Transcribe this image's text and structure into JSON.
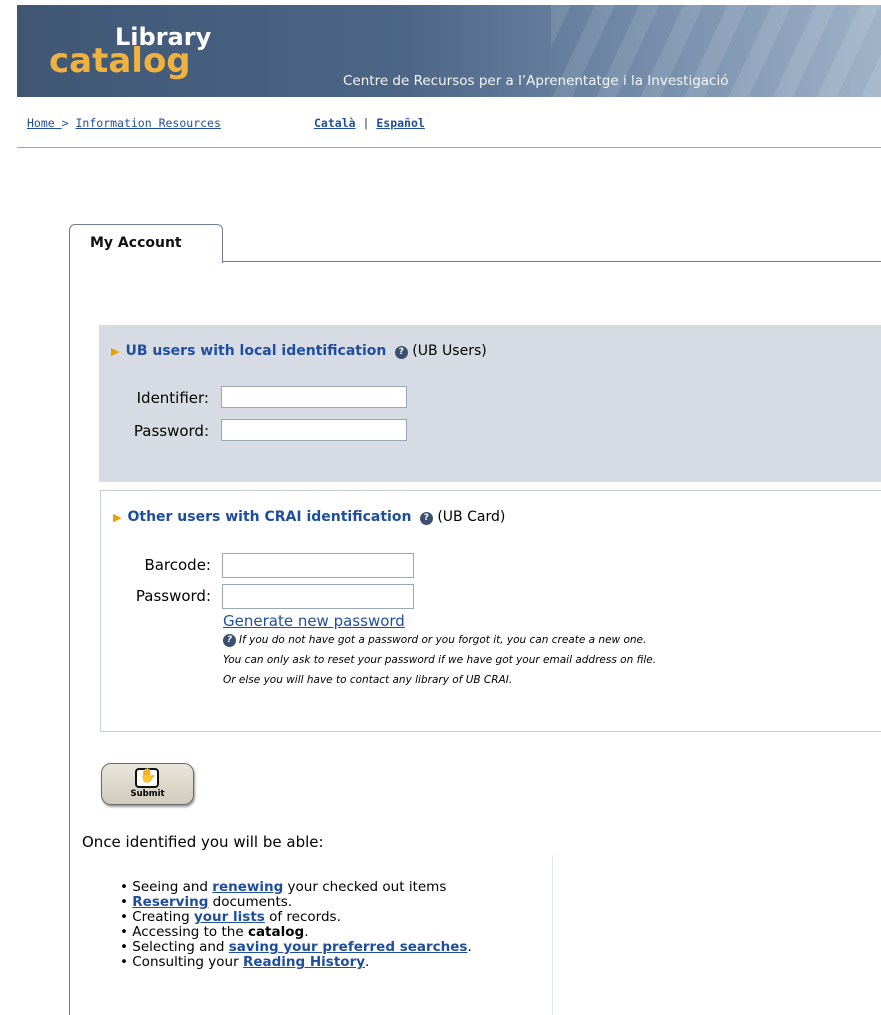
{
  "header": {
    "logo_top": "Library",
    "logo_bottom": "catalog",
    "tagline": "Centre de Recursos per a l’Aprenentatge i la Investigació"
  },
  "nav": {
    "breadcrumb_home": "Home ",
    "breadcrumb_sep": ">",
    "breadcrumb_resources": "Information Resources",
    "lang_catala": "Català",
    "lang_sep": "|",
    "lang_espanol": "Español"
  },
  "tab": {
    "label": "My Account"
  },
  "ub_section": {
    "title": "UB users with local identification",
    "suffix": "(UB Users)",
    "identifier_label": "Identifier:",
    "identifier_value": "",
    "password_label": "Password:",
    "password_value": ""
  },
  "crai_section": {
    "title": "Other users with CRAI identification",
    "suffix": "(UB Card)",
    "barcode_label": "Barcode:",
    "barcode_value": "",
    "password_label": "Password:",
    "password_value": "",
    "generate_link": "Generate new password",
    "note_1": "If you do not have got a password or you forgot it, you can create a new one.",
    "note_2": "You can only ask to reset your password if we have got your email address on file.",
    "note_3": "Or else you will have to contact any library of UB CRAI."
  },
  "submit": {
    "label": "Submit"
  },
  "info": {
    "intro": "Once identified you will be able:",
    "items": [
      {
        "pre": "• Seeing and ",
        "link": "renewing",
        "post": " your checked out items"
      },
      {
        "pre": "• ",
        "link": "Reserving",
        "post": " documents."
      },
      {
        "pre": "• Creating ",
        "link": "your lists",
        "post": " of records."
      },
      {
        "pre": "• Accessing to the ",
        "bold": "catalog",
        "post": "."
      },
      {
        "pre": "• Selecting and ",
        "link": "saving your preferred searches",
        "post": "."
      },
      {
        "pre": "• Consulting your ",
        "link": "Reading History",
        "post": "."
      }
    ]
  },
  "colors": {
    "link": "#1f4e9e",
    "logo_orange": "#f0b23e",
    "section_bg": "#d7dce4"
  }
}
